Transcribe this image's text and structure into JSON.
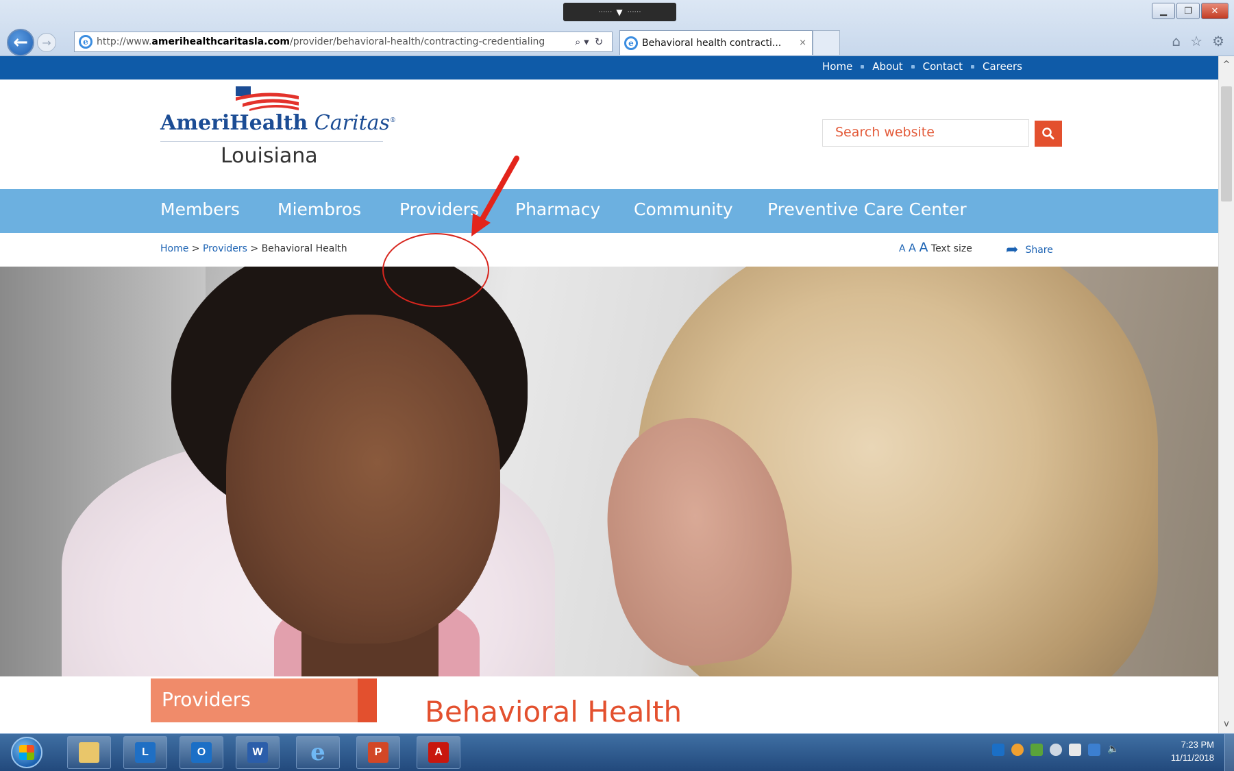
{
  "browser": {
    "url_prefix": "http://www.",
    "url_domain": "amerihealthcaritasla.com",
    "url_path": "/provider/behavioral-health/contracting-credentialing",
    "tab_title": "Behavioral health contracti...",
    "tab_close": "×",
    "address_search_glyph": "⌕ ▾",
    "address_refresh_glyph": "↻",
    "back_glyph": "←",
    "forward_glyph": "→",
    "toolbar_icons": [
      "home-icon",
      "favorites-star-icon",
      "settings-gear-icon"
    ],
    "grip_arrow": "▼",
    "grip_dots": "⋯⋯"
  },
  "window_buttons": [
    "▁",
    "❐",
    "✕"
  ],
  "utility_nav": [
    "Home",
    "About",
    "Contact",
    "Careers"
  ],
  "logo": {
    "brand_bold": "AmeriHealth",
    "brand_italic": "Caritas",
    "state": "Louisiana"
  },
  "search": {
    "placeholder": "Search website",
    "button_glyph": "⚲"
  },
  "main_nav": [
    "Members",
    "Miembros",
    "Providers",
    "Pharmacy",
    "Community",
    "Preventive Care Center"
  ],
  "breadcrumb": {
    "home": "Home",
    "providers": "Providers",
    "current": "Behavioral Health",
    "separator": " > "
  },
  "text_size": {
    "a": "A",
    "label": "Text size"
  },
  "share": {
    "label": "Share",
    "arrow": "➦"
  },
  "section": {
    "side_tab": "Providers",
    "heading": "Behavioral Health"
  },
  "scrollbar": {
    "up": "^",
    "down": "v"
  },
  "taskbar": {
    "apps": [
      {
        "name": "file-explorer",
        "label": "",
        "color": "#e9c66a"
      },
      {
        "name": "lync",
        "label": "L",
        "color": "#1f6fc4"
      },
      {
        "name": "outlook",
        "label": "O",
        "color": "#1b6fc6"
      },
      {
        "name": "word",
        "label": "W",
        "color": "#2b5eaa"
      },
      {
        "name": "internet-explorer",
        "label": "e",
        "color": "#3d8fe0"
      },
      {
        "name": "powerpoint",
        "label": "P",
        "color": "#d24726"
      },
      {
        "name": "acrobat",
        "label": "A",
        "color": "#c8170e"
      }
    ],
    "clock_time": "7:23 PM",
    "clock_date": "11/11/2018"
  }
}
